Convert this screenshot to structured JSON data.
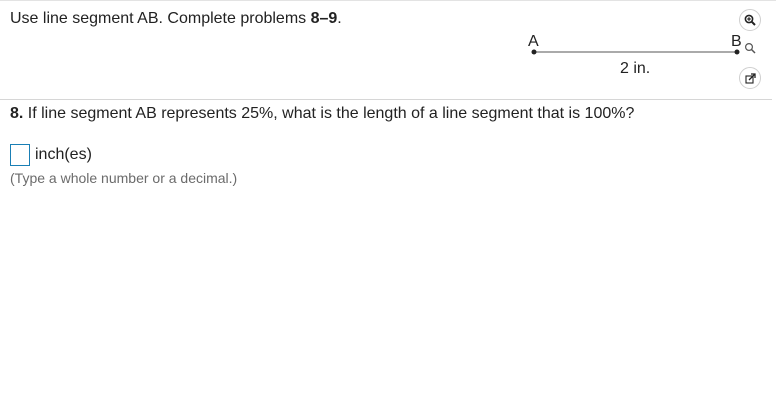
{
  "instruction": {
    "prefix": "Use line segment AB. Complete problems ",
    "range": "8–9",
    "suffix": "."
  },
  "figure": {
    "point_a": "A",
    "point_b": "B",
    "length_label": "2 in."
  },
  "tools": {
    "zoom_in": "zoom-in-icon",
    "zoom": "zoom-icon",
    "popout": "popout-icon"
  },
  "question": {
    "number": "8.",
    "text": " If line segment AB represents 25%, what is the length of a line segment that is 100%?"
  },
  "answer": {
    "value": "",
    "unit": "inch(es)",
    "hint": "(Type a whole number or a decimal.)"
  },
  "colors": {
    "input_border": "#1a7fb5",
    "hint_text": "#6b6b6b",
    "divider": "#d6d6d6"
  }
}
